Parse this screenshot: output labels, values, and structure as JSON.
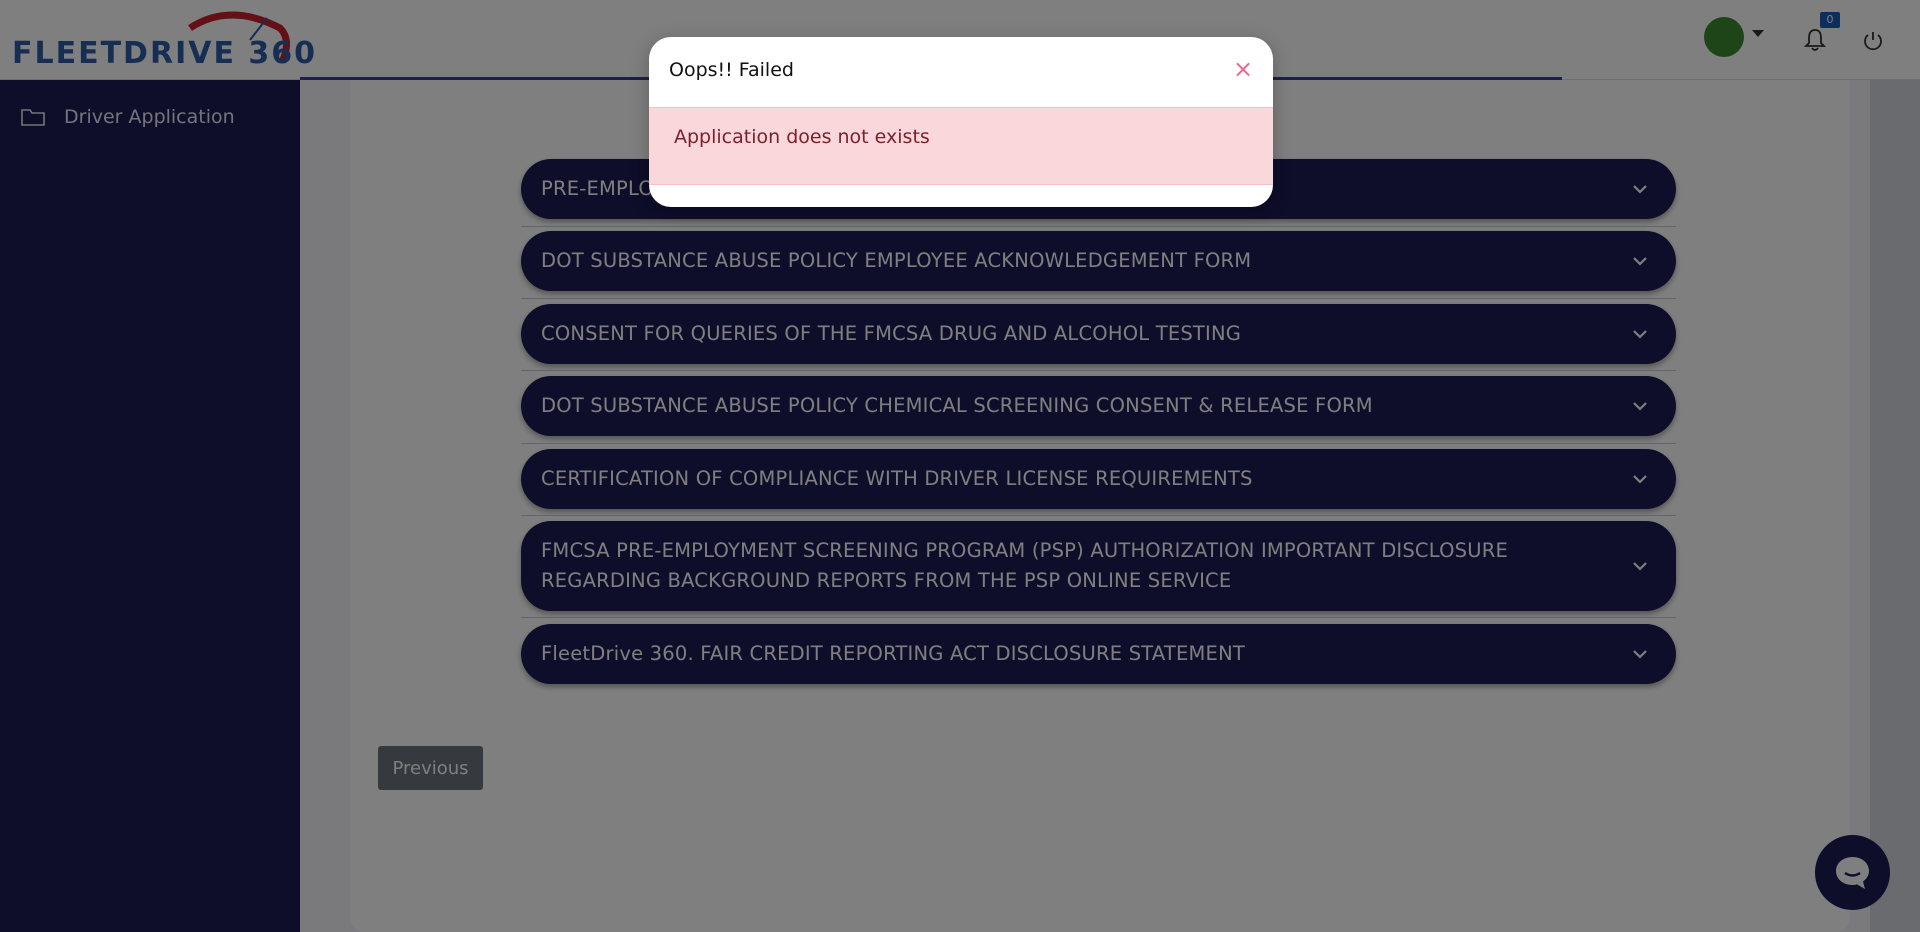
{
  "header": {
    "logo_text": "FLEETDRIVE 360",
    "notifications": {
      "count": "0"
    }
  },
  "sidebar": {
    "items": [
      {
        "label": "Driver Application",
        "icon": "folder-icon"
      }
    ]
  },
  "accordion": {
    "sections": [
      {
        "title": "PRE-EMPLOYMENT"
      },
      {
        "title": "DOT SUBSTANCE ABUSE POLICY EMPLOYEE ACKNOWLEDGEMENT FORM"
      },
      {
        "title": "CONSENT FOR QUERIES OF THE FMCSA DRUG AND ALCOHOL TESTING"
      },
      {
        "title": "DOT SUBSTANCE ABUSE POLICY CHEMICAL SCREENING CONSENT & RELEASE FORM"
      },
      {
        "title": "CERTIFICATION OF COMPLIANCE WITH DRIVER LICENSE REQUIREMENTS"
      },
      {
        "title": "FMCSA PRE-EMPLOYMENT SCREENING PROGRAM (PSP) AUTHORIZATION IMPORTANT DISCLOSURE REGARDING BACKGROUND REPORTS FROM THE PSP ONLINE SERVICE"
      },
      {
        "title": "FleetDrive 360. FAIR CREDIT REPORTING ACT DISCLOSURE STATEMENT"
      }
    ]
  },
  "navigation": {
    "previous_label": "Previous"
  },
  "modal": {
    "title": "Oops!! Failed",
    "close_symbol": "×",
    "message": "Application does not exists"
  },
  "colors": {
    "sidebar": "#1c1a55",
    "accordion": "#1c1a55",
    "logo_blue": "#2d5aa8",
    "logo_red": "#c8202f",
    "alert_bg": "#f9d7db",
    "alert_text": "#7a1f2c",
    "avatar": "#3d8a2e",
    "badge": "#1a5bb5"
  }
}
